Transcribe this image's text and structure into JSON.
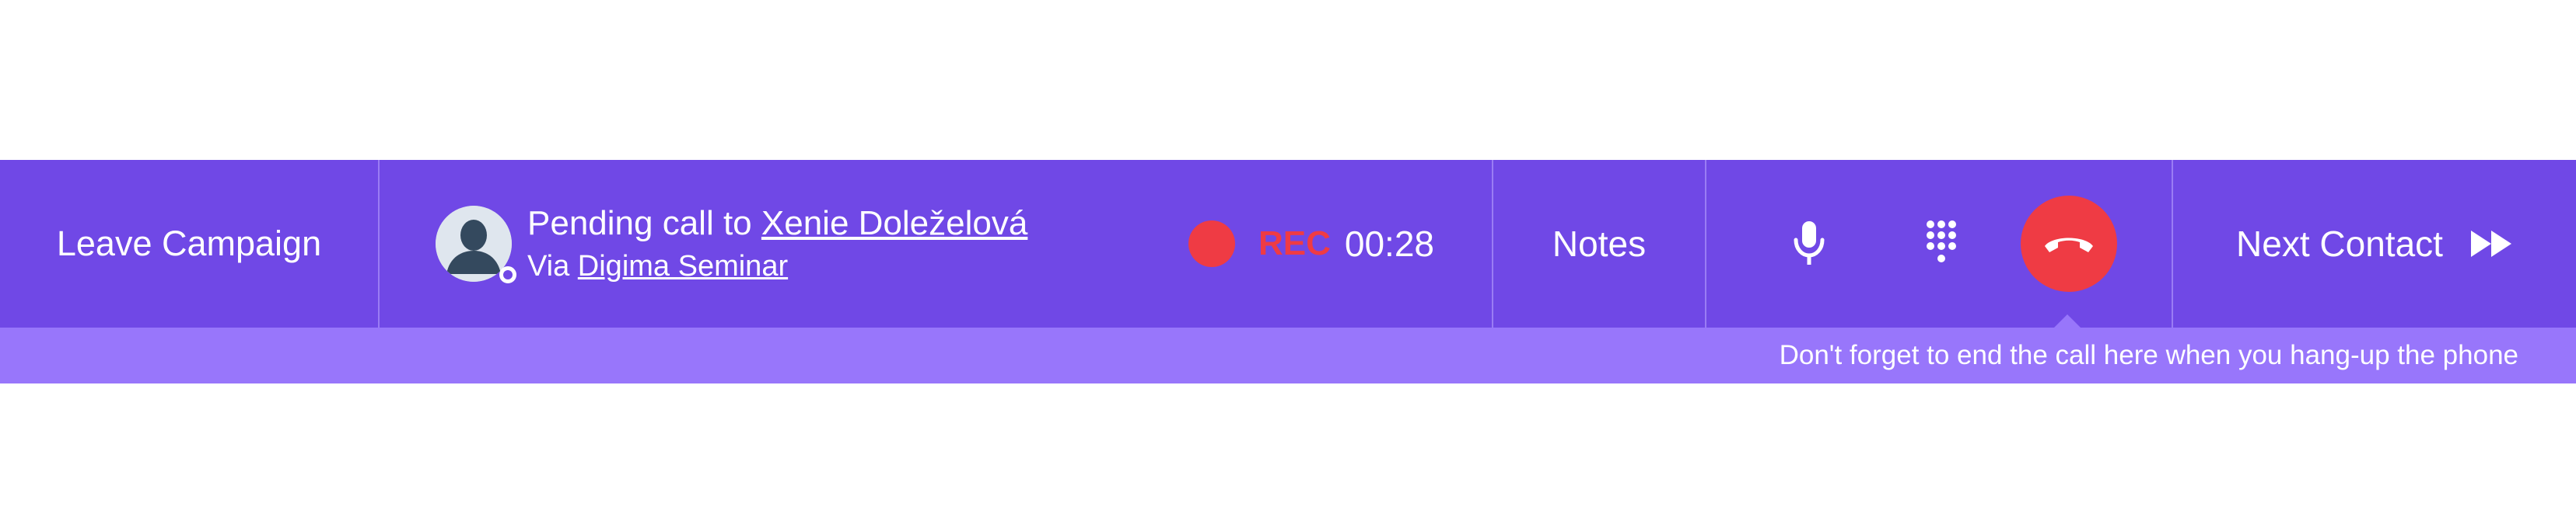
{
  "toolbar": {
    "leave_label": "Leave Campaign",
    "call": {
      "prefix": "Pending call to ",
      "contact_name": "Xenie Doleželová",
      "via_prefix": "Via ",
      "campaign_name": "Digima Seminar"
    },
    "recording": {
      "label": "REC",
      "timer": "00:28",
      "color": "#ef3b44"
    },
    "notes_label": "Notes",
    "controls": {
      "mic_icon": "microphone-icon",
      "keypad_icon": "dialpad-icon",
      "hangup_icon": "hangup-phone-icon"
    },
    "next_label": "Next Contact",
    "next_icon": "fast-forward-icon"
  },
  "hint": {
    "text": "Don't forget to end the call here when you hang-up the phone"
  },
  "colors": {
    "bar": "#7048e6",
    "hint_bar": "#9876fb",
    "danger": "#ef3b44"
  }
}
